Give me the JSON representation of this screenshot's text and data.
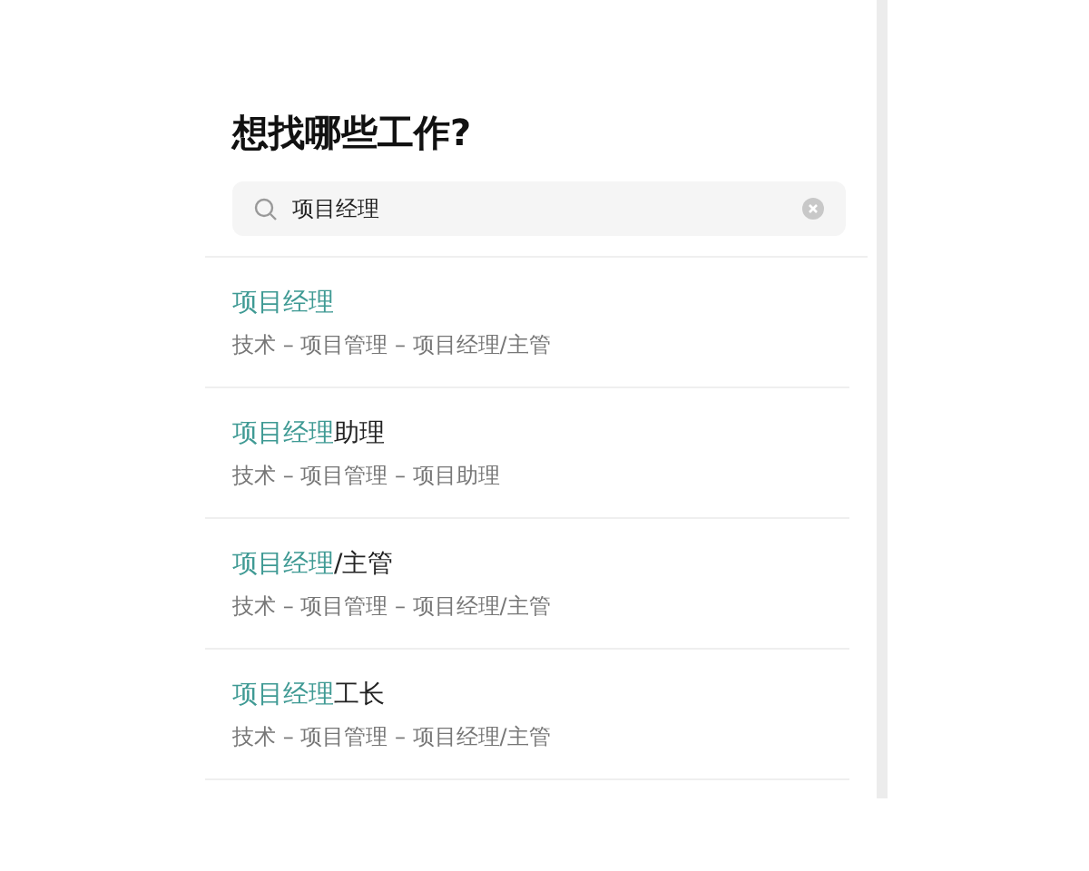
{
  "heading": "想找哪些工作?",
  "search": {
    "value": "项目经理"
  },
  "results": [
    {
      "match": "项目经理",
      "path": "技术 – 项目管理 – 项目经理/主管"
    },
    {
      "match": "项目经理",
      "rest": "助理",
      "path": "技术 – 项目管理 – 项目助理"
    },
    {
      "match": "项目经理",
      "rest": "/主管",
      "path": "技术 – 项目管理 – 项目经理/主管"
    },
    {
      "match": "项目经理",
      "rest": "工长",
      "path": "技术 – 项目管理 – 项目经理/主管"
    }
  ]
}
